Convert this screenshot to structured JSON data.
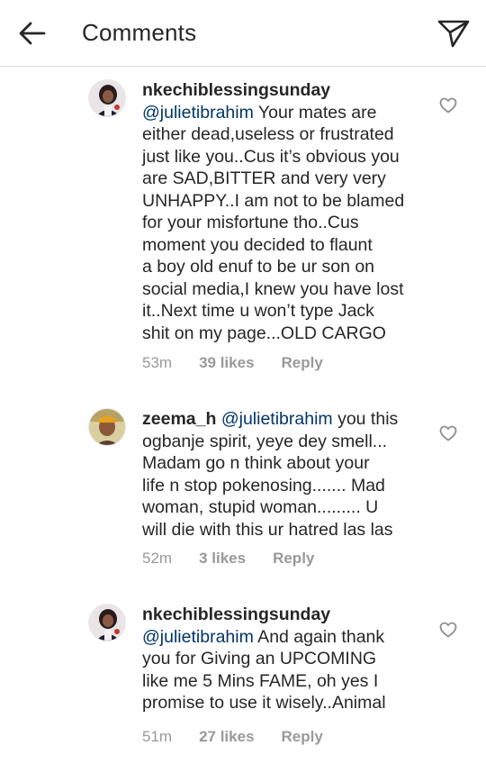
{
  "header": {
    "title": "Comments"
  },
  "comments": [
    {
      "username": "nkechiblessingsunday",
      "mention": "@julietibrahim",
      "text_lines": [
        " Your mates are",
        "either dead,useless or frustrated",
        "just like you..Cus it’s obvious you",
        "are SAD,BITTER and very very",
        "UNHAPPY..I am not to be blamed",
        "for your misfortune tho..Cus",
        "moment you decided to flaunt",
        "a boy old enuf to be ur son on",
        "social media,I knew you have lost",
        "it..Next time u won’t type Jack",
        "shit on my page...OLD CARGO"
      ],
      "time": "53m",
      "likes": "39 likes",
      "reply": "Reply"
    },
    {
      "username": "zeema_h",
      "mention": "@julietibrahim",
      "text_lines": [
        " you this",
        "ogbanje spirit, yeye dey smell...",
        "Madam go n think about your",
        "life n stop pokenosing....... Mad",
        "woman, stupid woman......... U",
        "will die with this ur hatred las las"
      ],
      "time": "52m",
      "likes": "3 likes",
      "reply": "Reply"
    },
    {
      "username": "nkechiblessingsunday",
      "mention": "@julietibrahim",
      "text_lines": [
        " And again thank",
        "you for Giving an UPCOMING",
        "like me 5 Mins FAME, oh yes I",
        "promise to use it wisely..Animal"
      ],
      "time": "51m",
      "likes": "27 likes",
      "reply": "Reply"
    }
  ],
  "colors": {
    "text": "#262626",
    "mention": "#003569",
    "meta": "#999999",
    "divider": "#dbdbdb"
  },
  "icons": {
    "back": "arrow-left-icon",
    "share": "paper-plane-icon",
    "like": "heart-outline-icon"
  }
}
